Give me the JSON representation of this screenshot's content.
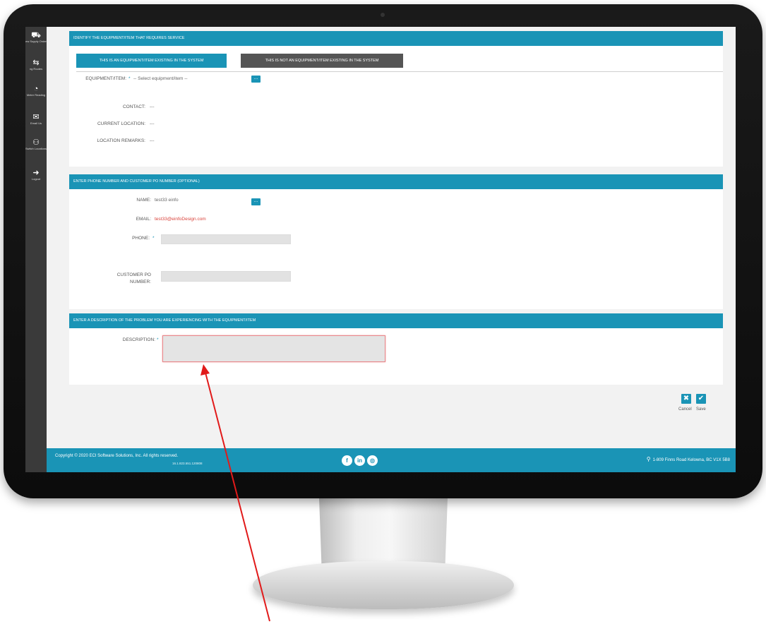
{
  "sidebar": {
    "items": [
      {
        "icon": "truck-icon",
        "label": "ew Supply Order"
      },
      {
        "icon": "handshake-icon",
        "label": "ng Routes"
      },
      {
        "icon": "gauge-icon",
        "label": "Meter Reading"
      },
      {
        "icon": "mail-icon",
        "label": "Email Us"
      },
      {
        "icon": "people-switch-icon",
        "label": "Switch Locations"
      },
      {
        "icon": "logout-icon",
        "label": "Logout"
      }
    ]
  },
  "section1": {
    "header": "IDENTIFY THE EQUIPMENT/ITEM THAT REQUIRES SERVICE",
    "tab_active": "THIS IS AN EQUIPMENT/ITEM EXISTING IN THE SYSTEM",
    "tab_inactive": "THIS IS NOT AN EQUIPMENT/ITEM EXISTING IN THE SYSTEM",
    "equipment_label": "EQUIPMENT/ITEM:",
    "equipment_value": "-- Select equipment/item --",
    "contact_label": "CONTACT:",
    "contact_value": "---",
    "location_label": "CURRENT LOCATION:",
    "location_value": "---",
    "remarks_label": "LOCATION REMARKS:",
    "remarks_value": "---"
  },
  "section2": {
    "header": "ENTER PHONE NUMBER AND CUSTOMER PO NUMBER (OPTIONAL)",
    "name_label": "NAME:",
    "name_value": "test33 einfo",
    "email_label": "EMAIL:",
    "email_value": "test33@einfoDesign.com",
    "phone_label": "PHONE:",
    "phone_value": "",
    "po_label": "CUSTOMER PO NUMBER:",
    "po_value": ""
  },
  "section3": {
    "header": "ENTER A DESCRIPTION OF THE PROBLEM YOU ARE EXPERIENCING WITH THE EQUIPMENT/ITEM",
    "description_label": "DESCRIPTION:",
    "description_value": ""
  },
  "required_marker": "*",
  "dots": "...",
  "actions": {
    "cancel": "Cancel",
    "save": "Save"
  },
  "footer": {
    "copyright": "Copyright © 2020 ECI Software Solutions, Inc. All rights reserved.",
    "version": "16.1.823.551.120808",
    "social": [
      "facebook-icon",
      "linkedin-icon",
      "instagram-icon"
    ],
    "address": "1-809 Finns Road Kelowna, BC V1X 5B8"
  },
  "colors": {
    "accent": "#1a94b6",
    "error_border": "#e8868a",
    "email": "#d9423a",
    "arrow": "#e11a1a"
  }
}
